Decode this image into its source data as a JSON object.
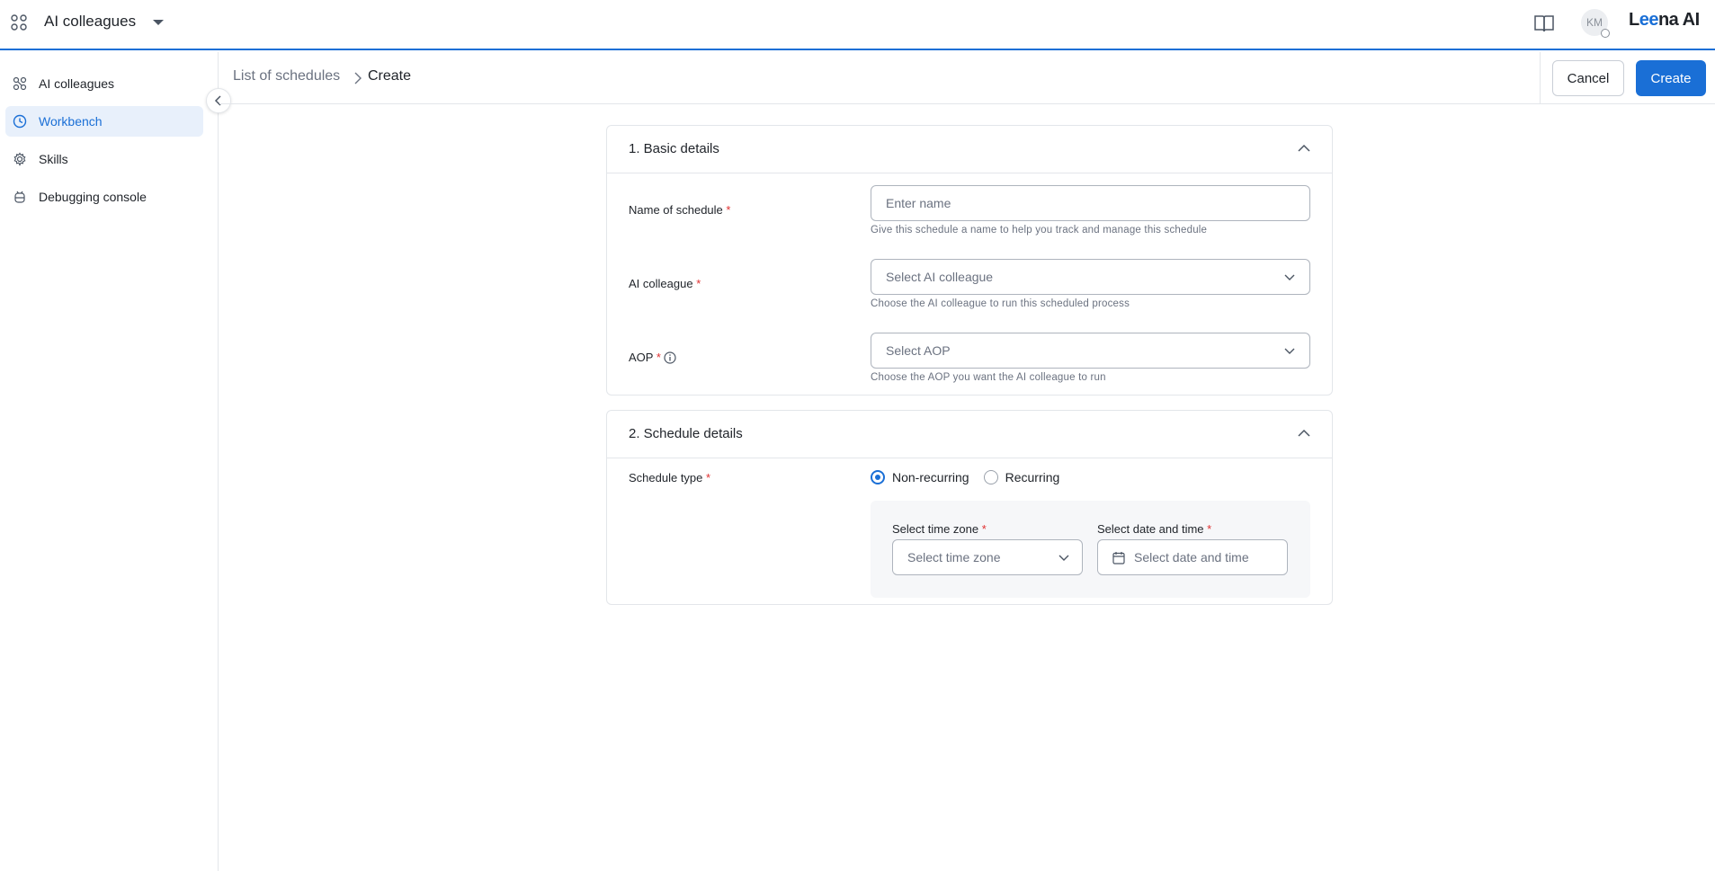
{
  "topbar": {
    "app_title": "AI colleagues",
    "avatar_initials": "KM",
    "brand": {
      "prefix": "L",
      "highlight": "ee",
      "suffix": "na AI"
    },
    "icons": {
      "apps": "apps-grid-icon",
      "caret": "caret-down-icon",
      "docs": "book-icon"
    }
  },
  "sidebar": {
    "items": [
      {
        "label": "AI colleagues",
        "icon": "ai-colleagues-icon",
        "active": false
      },
      {
        "label": "Workbench",
        "icon": "workbench-icon",
        "active": true
      },
      {
        "label": "Skills",
        "icon": "gear-icon",
        "active": false
      },
      {
        "label": "Debugging console",
        "icon": "debug-icon",
        "active": false
      }
    ]
  },
  "header": {
    "breadcrumb_parent": "List of schedules",
    "breadcrumb_current": "Create",
    "cancel_label": "Cancel",
    "create_label": "Create"
  },
  "basic_details": {
    "title": "1. Basic details",
    "name_label": "Name of schedule",
    "name_placeholder": "Enter name",
    "name_value": "",
    "name_help": "Give this schedule a name to help you track and manage this schedule",
    "colleague_label": "AI colleague",
    "colleague_placeholder": "Select AI colleague",
    "colleague_help": "Choose the AI colleague to run this scheduled process",
    "aop_label": "AOP",
    "aop_placeholder": "Select AOP",
    "aop_help": "Choose the AOP you want the AI colleague to run",
    "required_mark": "*"
  },
  "schedule_details": {
    "title": "2. Schedule details",
    "type_label": "Schedule type",
    "options": [
      {
        "label": "Non-recurring",
        "selected": true
      },
      {
        "label": "Recurring",
        "selected": false
      }
    ],
    "timezone_label": "Select time zone",
    "timezone_placeholder": "Select time zone",
    "datetime_label": "Select date and time",
    "datetime_placeholder": "Select date and time"
  },
  "colors": {
    "accent": "#1a6fd6",
    "required": "#e03131",
    "border": "#e3e6ea"
  }
}
